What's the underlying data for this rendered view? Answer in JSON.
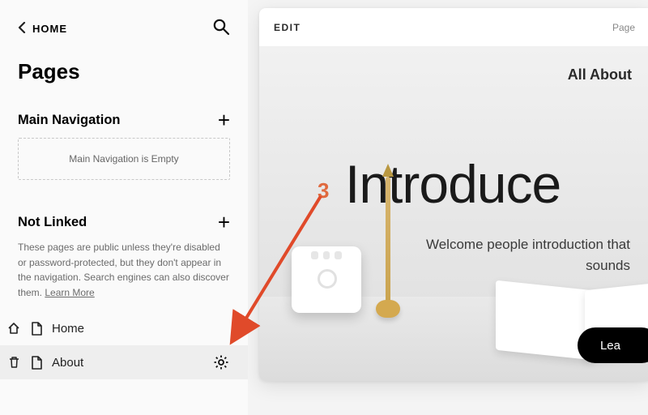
{
  "header": {
    "back_label": "HOME"
  },
  "sidebar": {
    "title": "Pages",
    "main_nav": {
      "heading": "Main Navigation",
      "empty_text": "Main Navigation is Empty"
    },
    "not_linked": {
      "heading": "Not Linked",
      "description_pre": "These pages are public unless they're disabled or password-protected, but they don't appear in the navigation. Search engines can also discover them. ",
      "learn_more": "Learn More"
    },
    "pages": [
      {
        "label": "Home"
      },
      {
        "label": "About"
      }
    ]
  },
  "preview": {
    "edit_label": "EDIT",
    "page_badge": "Page",
    "subtitle": "All About",
    "hero_heading": "Introduce",
    "hero_body": "Welcome people introduction that sounds",
    "cta_label": "Lea"
  },
  "annotation": {
    "number": "3"
  }
}
